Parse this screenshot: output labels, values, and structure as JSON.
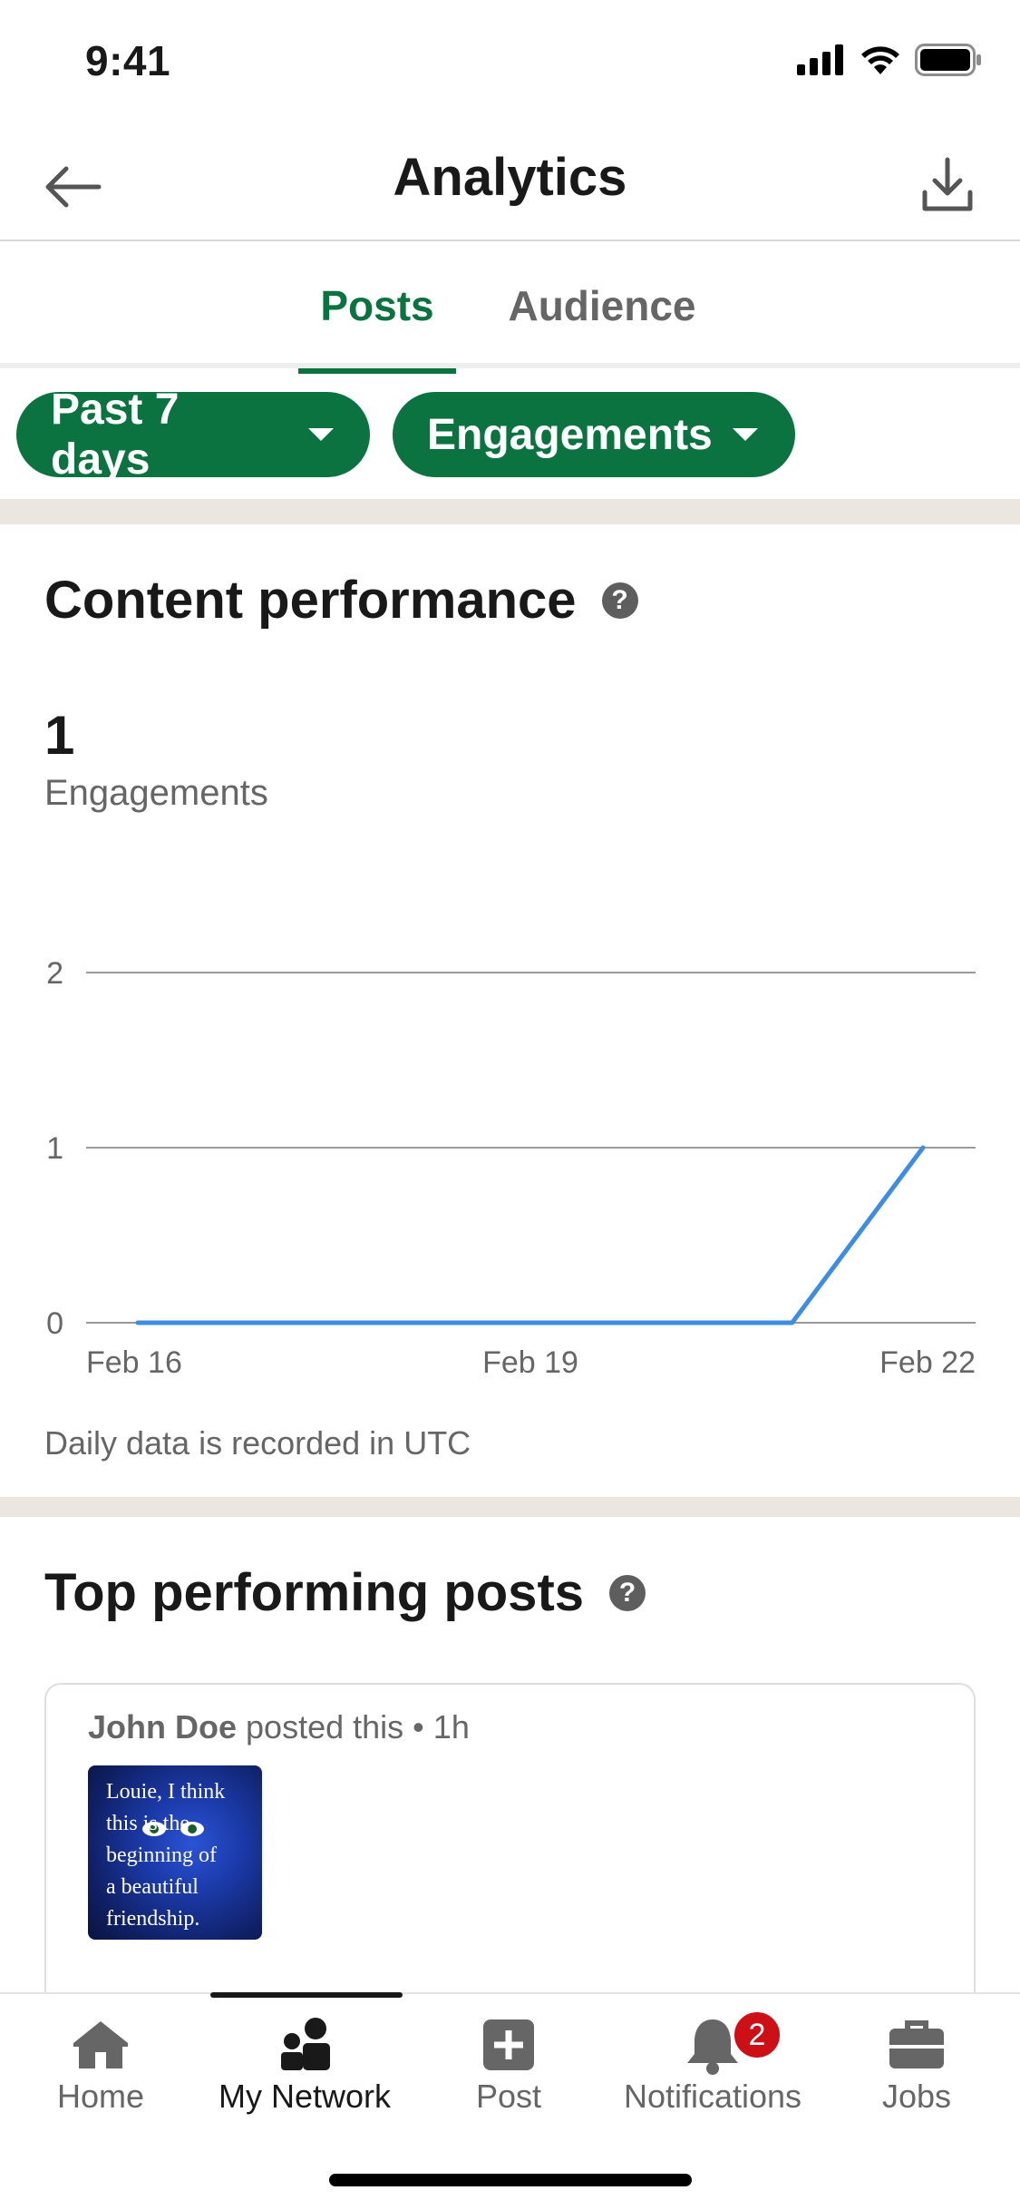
{
  "status_bar": {
    "time": "9:41"
  },
  "header": {
    "title": "Analytics"
  },
  "tabs": [
    {
      "label": "Posts",
      "active": true
    },
    {
      "label": "Audience",
      "active": false
    }
  ],
  "filters": {
    "period": "Past 7 days",
    "metric": "Engagements"
  },
  "content_performance": {
    "title": "Content performance",
    "help_glyph": "?",
    "value": "1",
    "value_label": "Engagements",
    "note": "Daily data is recorded in UTC"
  },
  "chart_data": {
    "type": "line",
    "x": [
      "Feb 16",
      "Feb 17",
      "Feb 18",
      "Feb 19",
      "Feb 20",
      "Feb 21",
      "Feb 22"
    ],
    "x_ticks": [
      "Feb 16",
      "Feb 19",
      "Feb 22"
    ],
    "y_ticks": [
      "0",
      "1",
      "2"
    ],
    "series": [
      {
        "values": [
          0,
          0,
          0,
          0,
          0,
          0,
          1
        ]
      }
    ],
    "ylim": [
      0,
      2
    ],
    "grid": true,
    "color": "#3d8ee3",
    "title": "",
    "xlabel": "",
    "ylabel": ""
  },
  "top_posts": {
    "title": "Top performing posts",
    "help_glyph": "?",
    "post": {
      "author": "John Doe",
      "action": "posted this",
      "separator": "•",
      "time": "1h",
      "thumbnail_lines": [
        "Louie, I think",
        "this is the",
        "beginning of",
        "a beautiful",
        "friendship."
      ]
    }
  },
  "bottom_nav": {
    "items": [
      {
        "label": "Home",
        "icon": "home-icon"
      },
      {
        "label": "My Network",
        "icon": "network-icon",
        "active": true
      },
      {
        "label": "Post",
        "icon": "post-plus-icon"
      },
      {
        "label": "Notifications",
        "icon": "bell-icon"
      },
      {
        "label": "Jobs",
        "icon": "briefcase-icon"
      }
    ],
    "notifications_badge": "2"
  },
  "colors": {
    "accent_green": "#0a7340",
    "chart_line": "#3d8ee3",
    "badge_red": "#cc1016",
    "section_divider": "#ebe6e0"
  }
}
